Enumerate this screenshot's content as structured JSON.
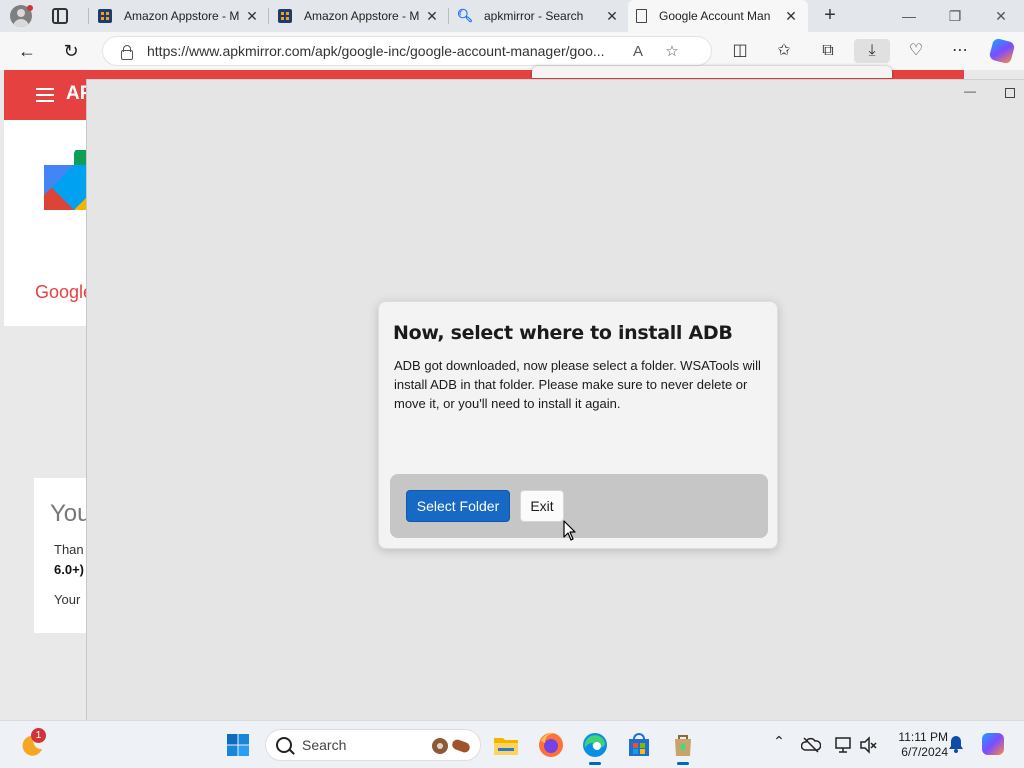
{
  "browser": {
    "tabs": [
      {
        "title": "Amazon Appstore - M",
        "favicon": "amazon-appstore-icon",
        "active": false
      },
      {
        "title": "Amazon Appstore - M",
        "favicon": "amazon-appstore-icon",
        "active": false
      },
      {
        "title": "apkmirror - Search",
        "favicon": "search-icon",
        "active": false
      },
      {
        "title": "Google Account Man",
        "favicon": "page-icon",
        "active": true
      }
    ],
    "close_glyph": "✕",
    "new_tab_glyph": "+",
    "window_controls": {
      "minimize": "—",
      "restore": "❐",
      "close": "✕"
    },
    "url": "https://www.apkmirror.com/apk/google-inc/google-account-manager/goo...",
    "nav": {
      "back": "←",
      "refresh": "↻"
    },
    "toolbar_glyphs": {
      "read_aloud": "A",
      "favorite": "☆",
      "split": "◫",
      "favorites": "✩",
      "collections": "⧉",
      "downloads": "⤓",
      "health": "♡",
      "more": "⋯"
    }
  },
  "page": {
    "site_logo_text": "AP",
    "app_name_partial": "Google",
    "you_card": {
      "title": "You",
      "line1": "Than",
      "line2": "6.0+)",
      "line3": "Your"
    }
  },
  "app_window": {
    "minimize_glyph": "—",
    "dialog": {
      "title": "Now, select where to install ADB",
      "body": "ADB got downloaded, now please select a folder. WSATools will install ADB in that folder. Please make sure to never delete or move it, or you'll need to install it again.",
      "primary_button": "Select Folder",
      "secondary_button": "Exit"
    }
  },
  "taskbar": {
    "weather_badge": "1",
    "search_placeholder": "Search",
    "tray": {
      "chevron": "⌃"
    },
    "time": "11:11 PM",
    "date": "6/7/2024"
  },
  "colors": {
    "accent_blue": "#1869c5",
    "apkmirror_red": "#e64141",
    "dialog_footer": "#c6c6c6"
  }
}
